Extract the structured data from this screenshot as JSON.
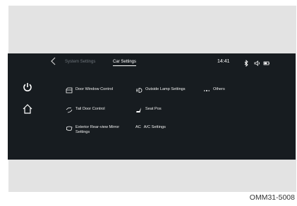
{
  "header": {
    "tabs": [
      {
        "label": "System Settings",
        "active": false
      },
      {
        "label": "Car Settings",
        "active": true
      }
    ],
    "time": "14:41",
    "status_icons": [
      "bluetooth-icon",
      "volume-icon",
      "battery-icon"
    ]
  },
  "sidebar": {
    "items": [
      "power-icon",
      "home-icon"
    ]
  },
  "settings": {
    "items": [
      {
        "label": "Door Window Control",
        "icon": "door-window-icon"
      },
      {
        "label": "Outside Lamp Settings",
        "icon": "outside-lamp-icon"
      },
      {
        "label": "Others",
        "icon": "more-dots-icon"
      },
      {
        "label": "Tail Door Control",
        "icon": "tail-door-icon"
      },
      {
        "label": "Seat Pos",
        "icon": "seat-icon"
      },
      {
        "label": "Exterior Rear-view Mirror",
        "label2": "Settings",
        "icon": "mirror-icon"
      },
      {
        "label": "A/C Settings",
        "icon_text": "AC",
        "icon": "ac-icon"
      }
    ]
  },
  "caption": "OMM31-5008",
  "colors": {
    "screen_bg": "#171c20",
    "inactive_tab": "#6f767c",
    "text": "#f0f0f0"
  }
}
